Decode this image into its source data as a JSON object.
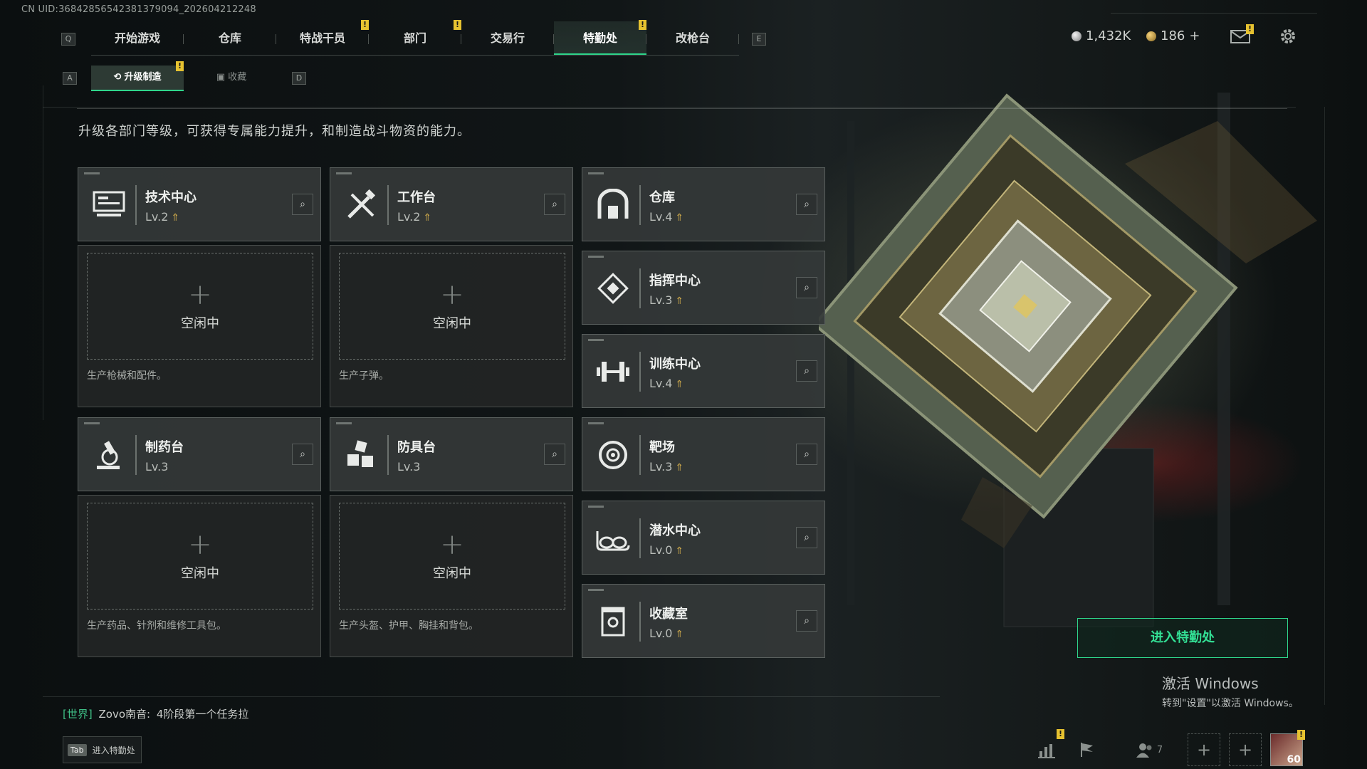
{
  "uid": "CN UID:36842856542381379094_202604212248",
  "nav": {
    "left_key": "Q",
    "right_key": "E",
    "tabs": [
      {
        "label": "开始游戏",
        "alert": false
      },
      {
        "label": "仓库",
        "alert": false
      },
      {
        "label": "特战干员",
        "alert": true
      },
      {
        "label": "部门",
        "alert": true
      },
      {
        "label": "交易行",
        "alert": false
      },
      {
        "label": "特勤处",
        "alert": true,
        "active": true
      },
      {
        "label": "改枪台",
        "alert": false
      }
    ],
    "alert_mark": "!"
  },
  "currency": {
    "silver": "1,432K",
    "gold": "186",
    "gold_add": "+"
  },
  "subtabs": {
    "left_key": "A",
    "right_key": "D",
    "items": [
      {
        "label": "升级制造",
        "active": true
      },
      {
        "label": "收藏",
        "active": false
      }
    ]
  },
  "description": "升级各部门等级，可获得专属能力提升，和制造战斗物资的能力。",
  "workshops": [
    {
      "name": "技术中心",
      "level": "Lv.2",
      "upgradeable": true,
      "icon": "computer-icon",
      "idle": "空闲中",
      "product": "生产枪械和配件。"
    },
    {
      "name": "工作台",
      "level": "Lv.2",
      "upgradeable": true,
      "icon": "tools-icon",
      "idle": "空闲中",
      "product": "生产子弹。"
    },
    {
      "name": "制药台",
      "level": "Lv.3",
      "upgradeable": false,
      "icon": "microscope-icon",
      "idle": "空闲中",
      "product": "生产药品、针剂和维修工具包。"
    },
    {
      "name": "防具台",
      "level": "Lv.3",
      "upgradeable": false,
      "icon": "armor-blocks-icon",
      "idle": "空闲中",
      "product": "生产头盔、护甲、胸挂和背包。"
    }
  ],
  "facilities": [
    {
      "name": "仓库",
      "level": "Lv.4",
      "icon": "warehouse-icon"
    },
    {
      "name": "指挥中心",
      "level": "Lv.3",
      "icon": "command-icon"
    },
    {
      "name": "训练中心",
      "level": "Lv.4",
      "icon": "dumbbell-icon"
    },
    {
      "name": "靶场",
      "level": "Lv.3",
      "icon": "target-icon"
    },
    {
      "name": "潜水中心",
      "level": "Lv.0",
      "icon": "diving-goggles-icon"
    },
    {
      "name": "收藏室",
      "level": "Lv.0",
      "icon": "collection-icon"
    }
  ],
  "enter_button": "进入特勤处",
  "windows": {
    "title": "激活 Windows",
    "subtitle": "转到\"设置\"以激活 Windows。"
  },
  "chat": {
    "channel": "[世界]",
    "user": "Zovo南音:",
    "message": "4阶段第一个任务拉"
  },
  "tab_hint": {
    "key": "Tab",
    "label": "进入特勤处"
  },
  "bottom_bar": {
    "friends_count": "7",
    "avatar_level": "60"
  },
  "colors": {
    "accent_green": "#2fd58b",
    "alert_yellow": "#e6c230",
    "upgrade_gold": "#c8a54a"
  }
}
